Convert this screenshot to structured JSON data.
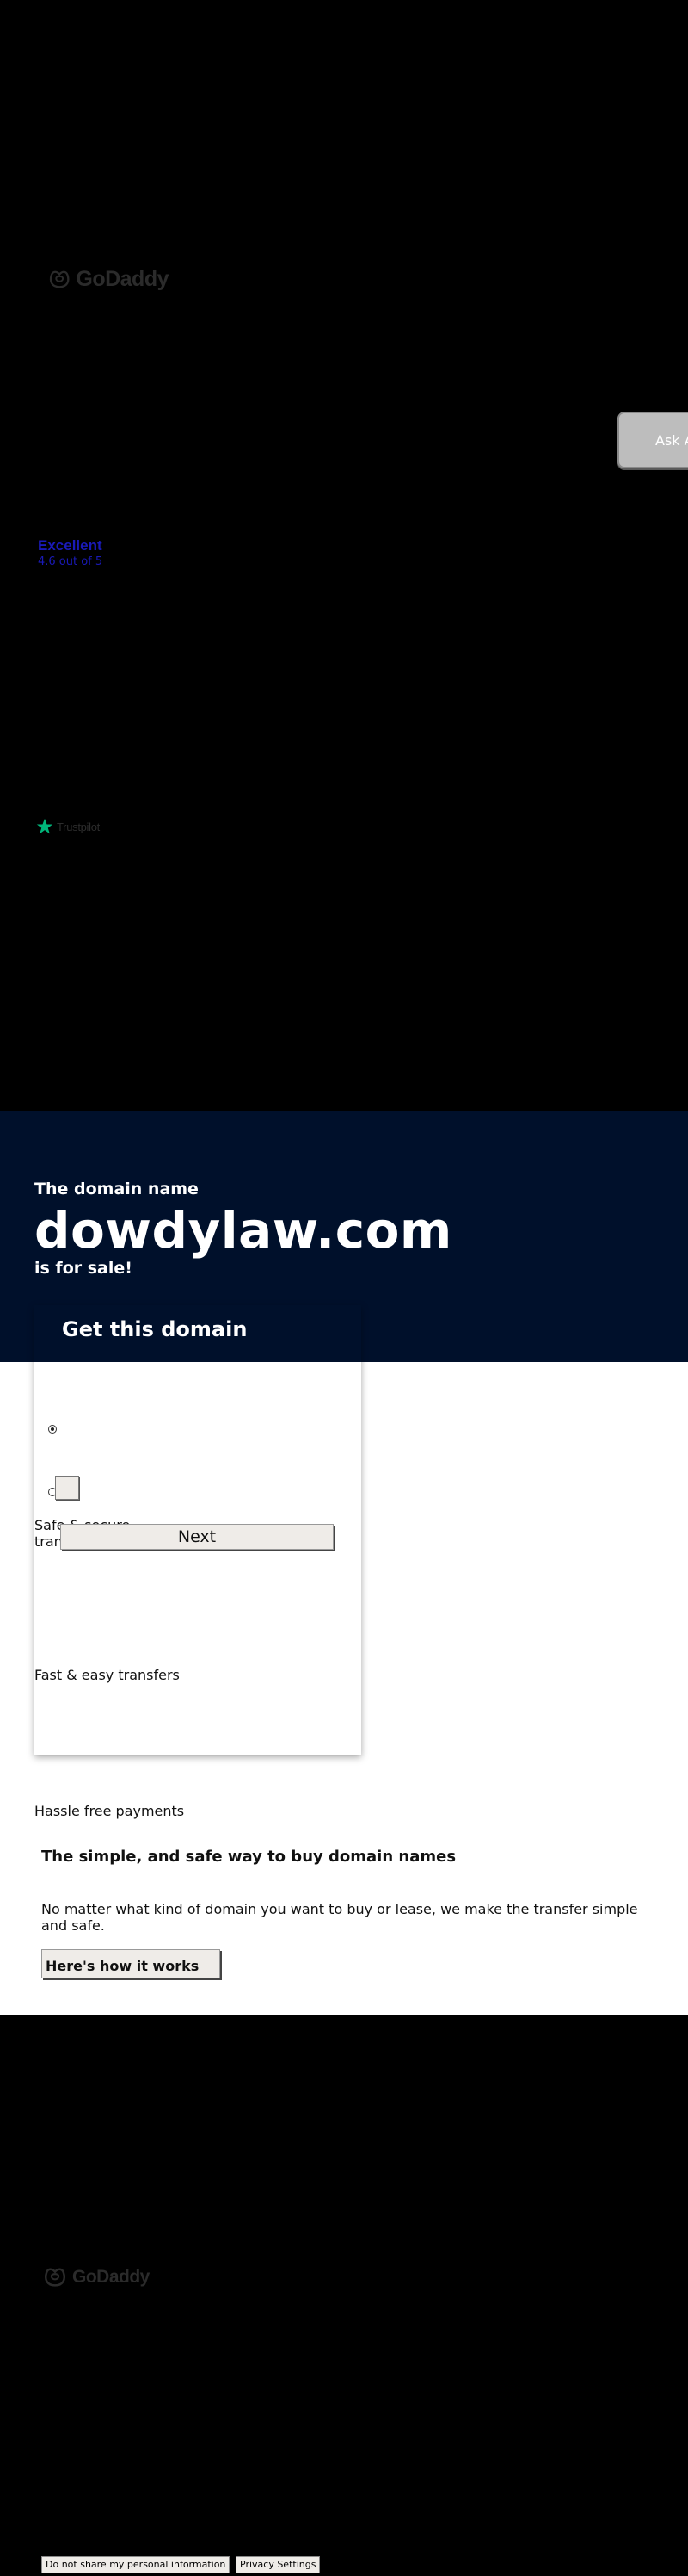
{
  "brand": {
    "logo_text": "GoDaddy",
    "colors": {
      "hero_bg": "#00102b",
      "trustpilot_green": "#00b67a",
      "trustpilot_link": "#1a1ab8"
    }
  },
  "chat": {
    "ask_label": "Ask A"
  },
  "trustpilot": {
    "rating_word": "Excellent",
    "rating_text": "4.6 out of 5",
    "logo_text": "Trustpilot",
    "icon": "star-icon"
  },
  "hero": {
    "pre": "The domain name",
    "domain": "dowdylaw.com",
    "post": "is for sale!"
  },
  "card": {
    "title": "Get this domain",
    "next_label": "Next",
    "options": [
      {
        "selected": true
      },
      {
        "selected": false
      }
    ]
  },
  "features": [
    {
      "text": "Safe & secure transactions"
    },
    {
      "text": "Fast & easy transfers"
    },
    {
      "text": "Hassle free payments"
    }
  ],
  "info": {
    "title": "The simple, and safe way to buy domain names",
    "description": "No matter what kind of domain you want to buy or lease, we make the transfer simple and safe.",
    "button": "Here's how it works"
  },
  "footer": {
    "logo_text": "GoDaddy",
    "do_not_share": "Do not share my personal information",
    "privacy_settings": "Privacy Settings"
  }
}
